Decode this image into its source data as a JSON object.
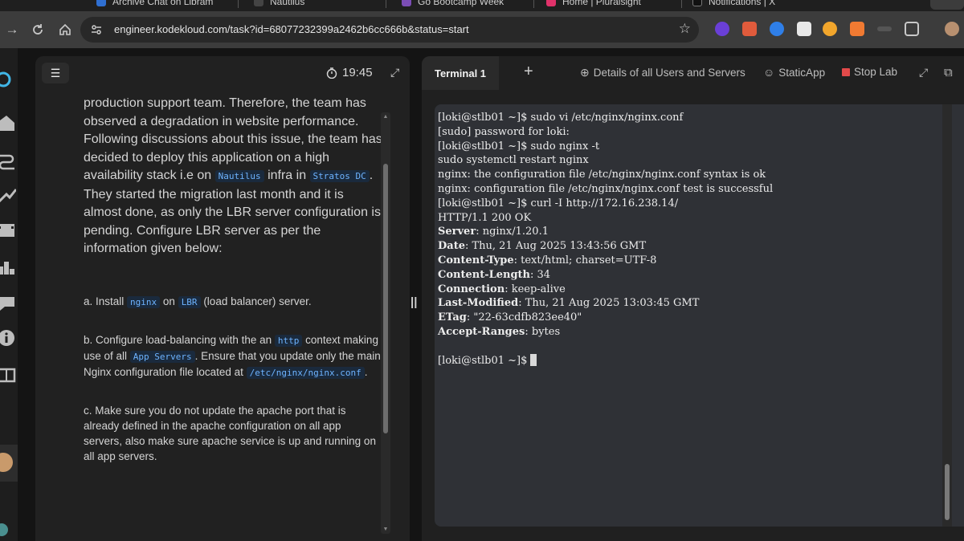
{
  "browser": {
    "tabs": [
      {
        "label": "Archive Chat on Libram",
        "color": "#2f6fd1"
      },
      {
        "label": "Nautilus",
        "color": "#444"
      },
      {
        "label": "Go Bootcamp Week",
        "color": "#7b4db5"
      },
      {
        "label": "Home | Pluralsight",
        "color": "#e0326a"
      },
      {
        "label": "Notifications | X",
        "color": "#111"
      }
    ],
    "url": "engineer.kodekloud.com/task?id=68077232399a2462b6cc666b&status=start",
    "back_icon": "arrow-right-icon",
    "reload_icon": "reload-icon",
    "home_icon": "home-icon"
  },
  "task": {
    "timer": "19:45",
    "intro_parts": {
      "a": "production support team. Therefore, the team has observed a degradation in website performance. Following discussions about this issue, the team has decided to deploy this application on a high availability stack i.e on ",
      "code1": "Nautilus",
      "b": " infra in ",
      "code2": "Stratos DC",
      "c": ". They started the migration last month and it is almost done, as only the LBR server configuration is pending. Configure LBR server as per the information given below:"
    },
    "step_a": {
      "t1": "a. Install ",
      "c1": "nginx",
      "t2": " on ",
      "c2": "LBR",
      "t3": " (load balancer) server."
    },
    "step_b": {
      "t1": "b. Configure load-balancing with the an ",
      "c1": "http",
      "t2": " context making use of all ",
      "c2": "App Servers",
      "t3": ". Ensure that you update only the main Nginx configuration file located at ",
      "c3": "/etc/nginx/nginx.conf",
      "t4": "."
    },
    "step_c": "c. Make sure you do not update the apache port that is already defined in the apache configuration on all app servers, also make sure apache service is up and running on all app servers."
  },
  "terminal": {
    "tab_label": "Terminal 1",
    "plus": "+",
    "details_link": "Details of all Users and Servers",
    "staticapp_link": "StaticApp",
    "stop_lab": "Stop Lab",
    "lines": [
      "[loki@stlb01 ~]$ sudo vi /etc/nginx/nginx.conf",
      "[sudo] password for loki:",
      "[loki@stlb01 ~]$ sudo nginx -t",
      "sudo systemctl restart nginx",
      "nginx: the configuration file /etc/nginx/nginx.conf syntax is ok",
      "nginx: configuration file /etc/nginx/nginx.conf test is successful",
      "[loki@stlb01 ~]$ curl -I http://172.16.238.14/",
      "HTTP/1.1 200 OK"
    ],
    "headers": [
      {
        "k": "Server",
        "v": ": nginx/1.20.1"
      },
      {
        "k": "Date",
        "v": ": Thu, 21 Aug 2025 13:43:56 GMT"
      },
      {
        "k": "Content-Type",
        "v": ": text/html; charset=UTF-8"
      },
      {
        "k": "Content-Length",
        "v": ": 34"
      },
      {
        "k": "Connection",
        "v": ": keep-alive"
      },
      {
        "k": "Last-Modified",
        "v": ": Thu, 21 Aug 2025 13:03:45 GMT"
      },
      {
        "k": "ETag",
        "v": ": \"22-63cdfb823ee40\""
      },
      {
        "k": "Accept-Ranges",
        "v": ": bytes"
      }
    ],
    "prompt": "[loki@stlb01 ~]$"
  }
}
